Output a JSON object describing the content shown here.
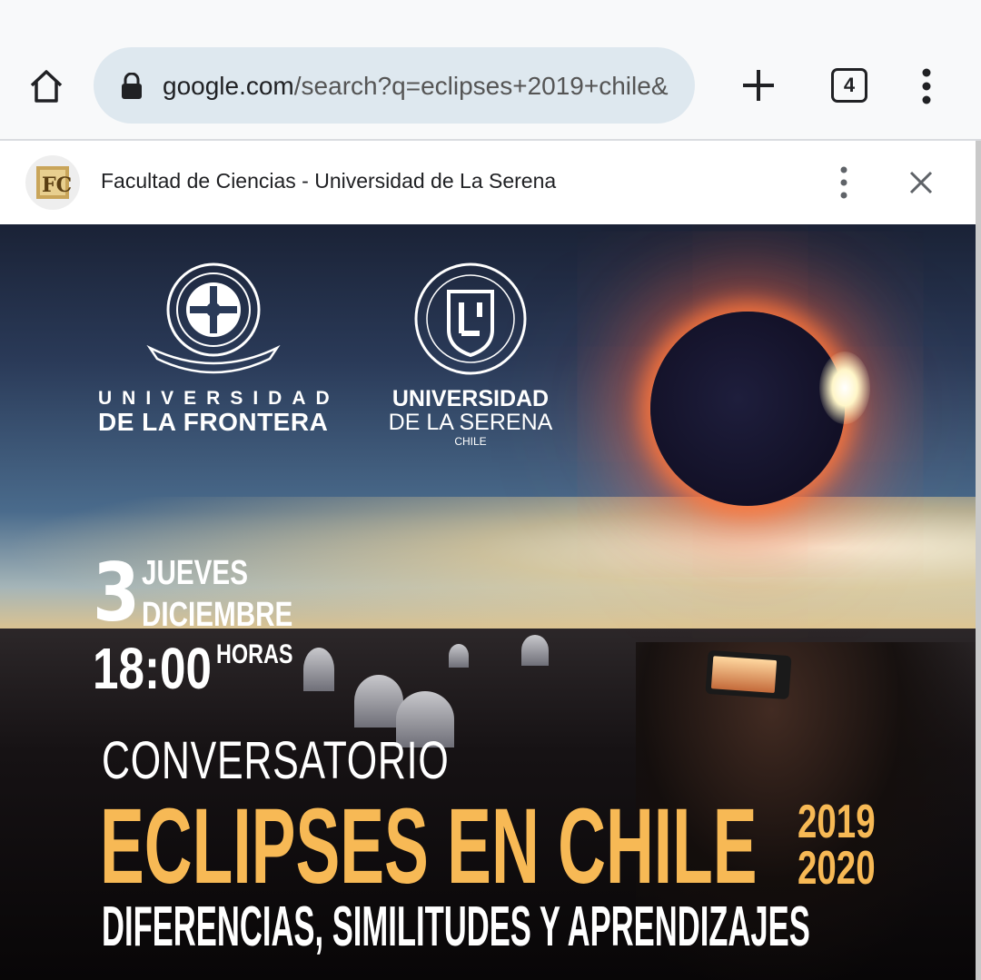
{
  "browser": {
    "url_host": "google.com",
    "url_path": "/search?q=eclipses+2019+chile&",
    "tab_count": "4",
    "icons": {
      "home": "home-icon",
      "lock": "lock-icon",
      "new_tab": "plus-icon",
      "menu": "more-vert-icon"
    }
  },
  "site_bar": {
    "favicon_text": "FC",
    "title": "Facultad de Ciencias - Universidad de La Serena",
    "icons": {
      "menu": "more-vert-icon",
      "close": "close-icon"
    }
  },
  "poster": {
    "logo_ufro": {
      "line1": "UNIVERSIDAD",
      "line2": "DE LA FRONTERA"
    },
    "logo_uls": {
      "line1": "UNIVERSIDAD",
      "line2": "DE LA SERENA",
      "line3": "CHILE"
    },
    "date": {
      "day": "3",
      "weekday": "JUEVES",
      "month": "DICIEMBRE",
      "time": "18:00",
      "time_unit": "HORAS"
    },
    "eyebrow": "CONVERSATORIO",
    "title": "ECLIPSES EN CHILE",
    "years": [
      "2019",
      "2020"
    ],
    "subtitle": "DIFERENCIAS, SIMILITUDES Y APRENDIZAJES",
    "colors": {
      "accent": "#f7b955",
      "text": "#ffffff"
    }
  }
}
